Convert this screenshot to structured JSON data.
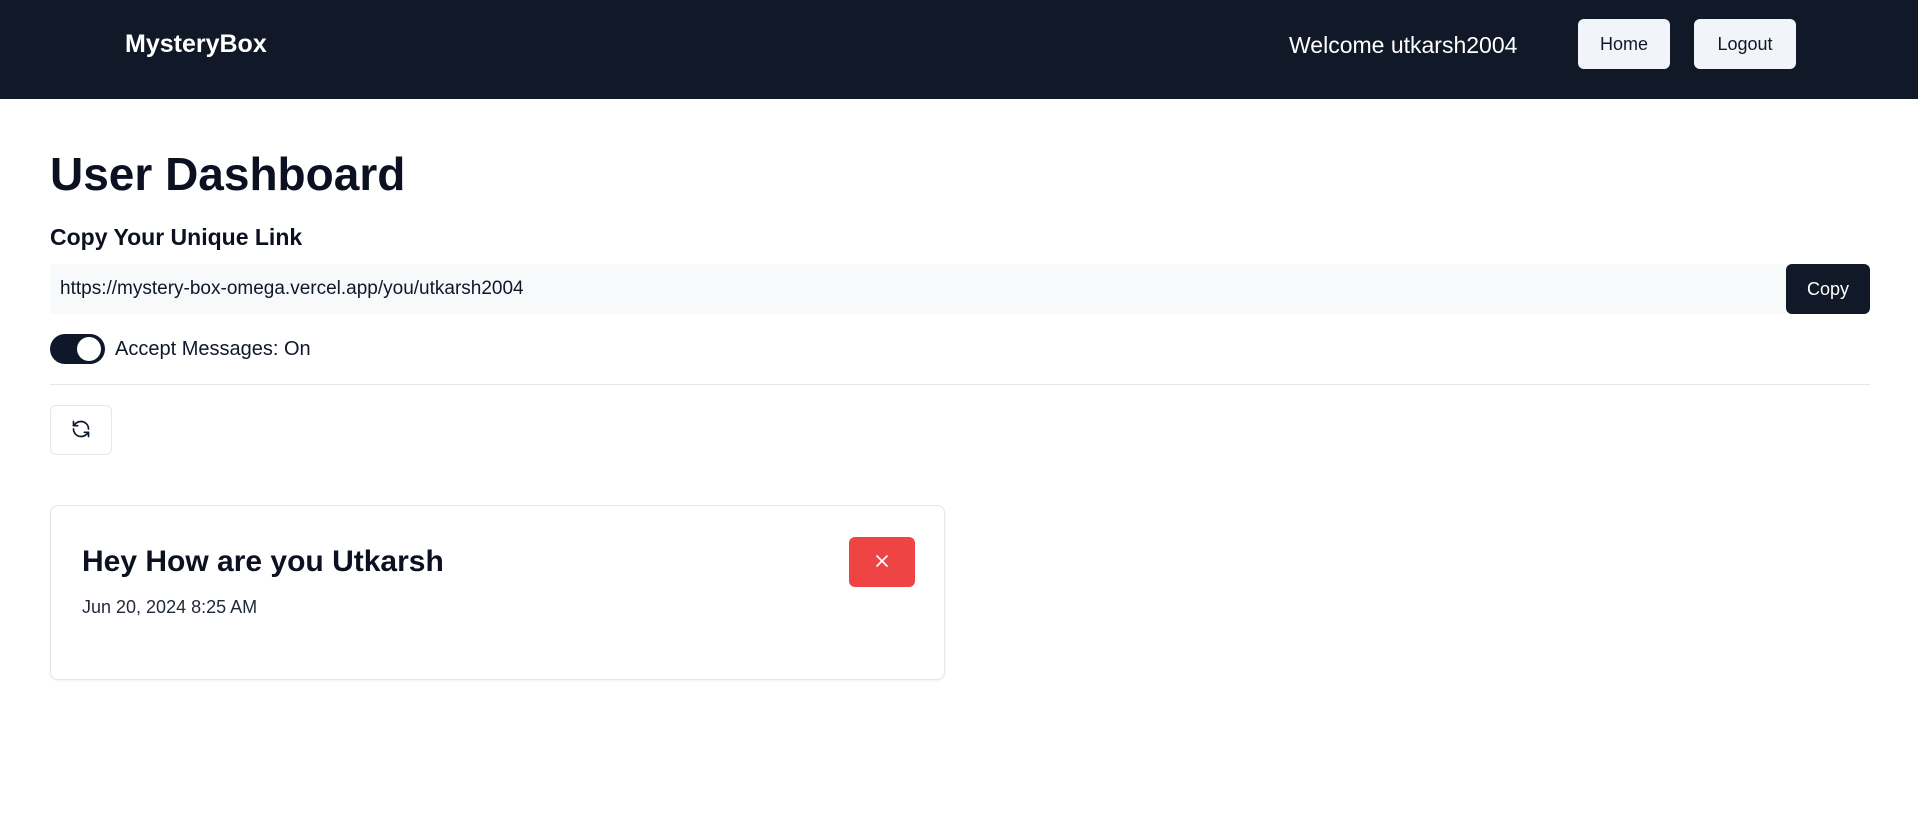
{
  "navbar": {
    "brand": "MysteryBox",
    "welcome": "Welcome utkarsh2004",
    "home_label": "Home",
    "logout_label": "Logout"
  },
  "dashboard": {
    "title": "User Dashboard",
    "link_section_label": "Copy Your Unique Link",
    "unique_link": "https://mystery-box-omega.vercel.app/you/utkarsh2004",
    "copy_label": "Copy",
    "accept_messages_label": "Accept Messages: On",
    "accept_messages_on": true
  },
  "messages": [
    {
      "content": "Hey How are you Utkarsh",
      "date": "Jun 20, 2024 8:25 AM"
    }
  ],
  "icons": {
    "refresh": "refresh-icon",
    "delete": "close-icon"
  },
  "colors": {
    "navbar_bg": "#111827",
    "primary": "#111827",
    "danger": "#ef4444"
  }
}
